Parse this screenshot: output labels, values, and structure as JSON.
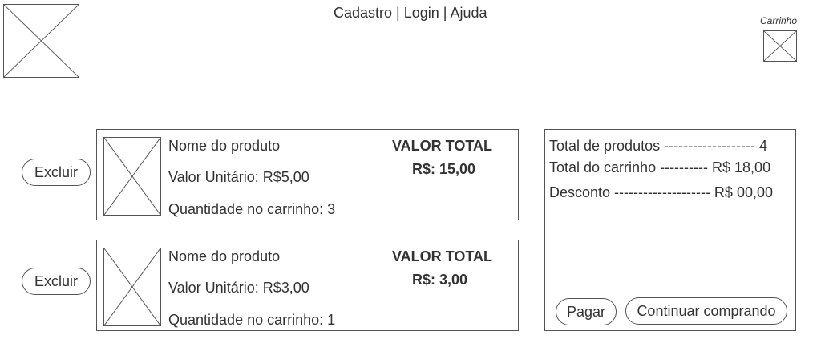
{
  "header": {
    "logo_icon": "image-placeholder",
    "nav": {
      "signup": "Cadastro",
      "sep1": " | ",
      "login": "Login",
      "sep2": " | ",
      "help": "Ajuda"
    },
    "cart_label": "Carrinho",
    "cart_icon": "image-placeholder"
  },
  "items": [
    {
      "name": "Nome do produto",
      "unit_price": "Valor Unitário: R$5,00",
      "quantity": "Quantidade no carrinho: 3",
      "total_label": "VALOR TOTAL",
      "total_value": "R$: 15,00",
      "remove_label": "Excluir"
    },
    {
      "name": "Nome do produto",
      "unit_price": "Valor Unitário: R$3,00",
      "quantity": "Quantidade no carrinho: 1",
      "total_label": "VALOR TOTAL",
      "total_value": "R$: 3,00",
      "remove_label": "Excluir"
    }
  ],
  "summary": {
    "total_products": "Total de produtos ------------------- 4",
    "cart_total": "Total do carrinho ---------- R$ 18,00",
    "discount": "Desconto -------------------- R$ 00,00",
    "pay_label": "Pagar",
    "continue_label": "Continuar comprando"
  }
}
